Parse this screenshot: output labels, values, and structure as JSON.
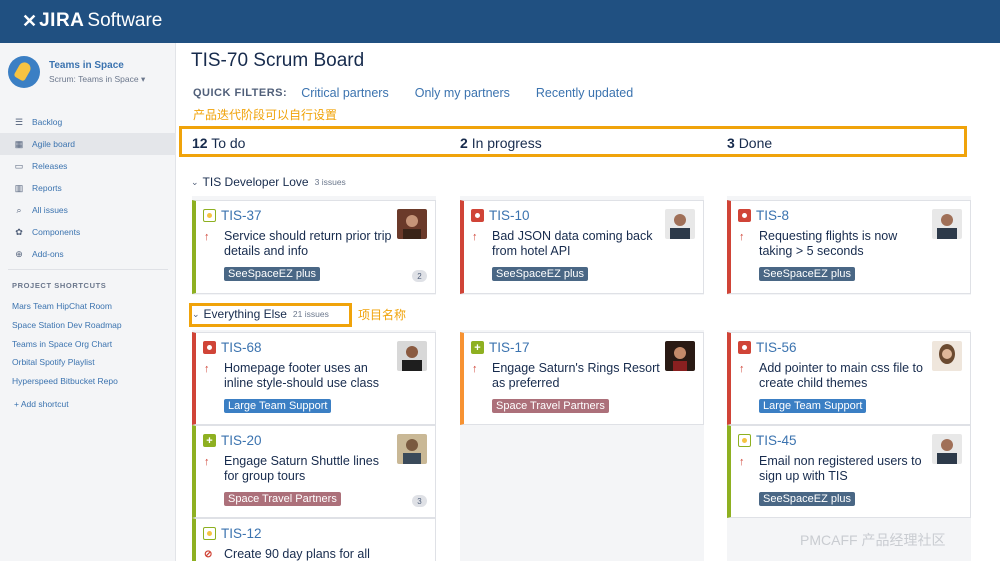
{
  "app": {
    "logo_mark": "✕",
    "logo_brand": "JIRA",
    "logo_product": "Software"
  },
  "project": {
    "name": "Teams in Space",
    "board": "Scrum: Teams in Space ▾"
  },
  "nav": [
    {
      "label": "Backlog",
      "icon": "backlog-icon",
      "glyph": "☰"
    },
    {
      "label": "Agile board",
      "icon": "board-icon",
      "glyph": "▦"
    },
    {
      "label": "Releases",
      "icon": "releases-icon",
      "glyph": "▭"
    },
    {
      "label": "Reports",
      "icon": "reports-icon",
      "glyph": "▥"
    },
    {
      "label": "All issues",
      "icon": "search-icon",
      "glyph": "⌕"
    },
    {
      "label": "Components",
      "icon": "components-icon",
      "glyph": "✿"
    },
    {
      "label": "Add-ons",
      "icon": "addons-icon",
      "glyph": "⊕"
    }
  ],
  "shortcuts_title": "PROJECT SHORTCUTS",
  "shortcuts": [
    "Mars Team HipChat Room",
    "Space Station Dev Roadmap",
    "Teams in Space Org Chart",
    "Orbital Spotify Playlist",
    "Hyperspeed Bitbucket Repo"
  ],
  "add_shortcut": "+ Add shortcut",
  "board_title": "TIS-70 Scrum Board",
  "quick_filters": {
    "label": "QUICK FILTERS:",
    "items": [
      "Critical partners",
      "Only my partners",
      "Recently updated"
    ]
  },
  "annotations": {
    "columns": "产品迭代阶段可以自行设置",
    "swimlane": "项目名称"
  },
  "columns": [
    {
      "count": "12",
      "name": "To do"
    },
    {
      "count": "2",
      "name": "In progress"
    },
    {
      "count": "3",
      "name": "Done"
    }
  ],
  "swimlanes": [
    {
      "name": "TIS Developer Love",
      "count": "3 issues"
    },
    {
      "name": "Everything Else",
      "count": "21 issues"
    }
  ],
  "cards": {
    "tis37": {
      "key": "TIS-37",
      "summary": "Service should return prior trip details and info",
      "epic": "SeeSpaceEZ plus",
      "badge": "2"
    },
    "tis10": {
      "key": "TIS-10",
      "summary": "Bad JSON data coming back from hotel API",
      "epic": "SeeSpaceEZ plus"
    },
    "tis8": {
      "key": "TIS-8",
      "summary": "Requesting flights is now taking > 5 seconds",
      "epic": "SeeSpaceEZ plus"
    },
    "tis68": {
      "key": "TIS-68",
      "summary": "Homepage footer uses an inline style-should use class",
      "epic": "Large Team Support"
    },
    "tis17": {
      "key": "TIS-17",
      "summary": "Engage Saturn's Rings Resort as preferred",
      "epic": "Space Travel Partners"
    },
    "tis56": {
      "key": "TIS-56",
      "summary": "Add pointer to main css file to create child themes",
      "epic": "Large Team Support"
    },
    "tis20": {
      "key": "TIS-20",
      "summary": "Engage Saturn Shuttle lines for group tours",
      "epic": "Space Travel Partners",
      "badge": "3"
    },
    "tis45": {
      "key": "TIS-45",
      "summary": "Email non registered users to sign up with TIS",
      "epic": "SeeSpaceEZ plus"
    },
    "tis12": {
      "key": "TIS-12",
      "summary": "Create 90 day plans for all"
    }
  },
  "watermark": "PMCAFF 产品经理社区",
  "colors": {
    "topbar": "#205081",
    "link": "#3b73af",
    "annotation": "#f0a30a",
    "done_green": "#8eb021",
    "bug_red": "#d04437",
    "orange": "#f79232"
  }
}
